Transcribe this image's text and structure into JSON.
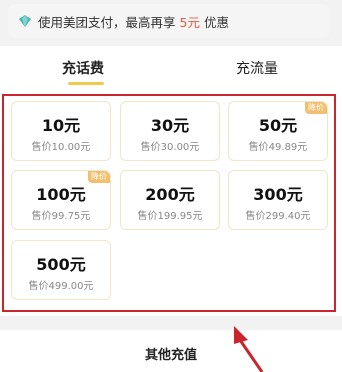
{
  "promo": {
    "text_before": "使用美团支付，最高再享",
    "highlight": "5元",
    "text_after": "优惠",
    "icon": "diamond-icon"
  },
  "tabs": [
    {
      "label": "充话费",
      "selected": true
    },
    {
      "label": "充流量",
      "selected": false
    }
  ],
  "cards": [
    {
      "amount": "10元",
      "price": "售价10.00元",
      "tag": ""
    },
    {
      "amount": "30元",
      "price": "售价30.00元",
      "tag": ""
    },
    {
      "amount": "50元",
      "price": "售价49.89元",
      "tag": "降价"
    },
    {
      "amount": "100元",
      "price": "售价99.75元",
      "tag": "降价"
    },
    {
      "amount": "200元",
      "price": "售价199.95元",
      "tag": ""
    },
    {
      "amount": "300元",
      "price": "售价299.40元",
      "tag": ""
    },
    {
      "amount": "500元",
      "price": "售价499.00元",
      "tag": ""
    }
  ],
  "bottom": {
    "label": "其他充值"
  },
  "colors": {
    "highlight": "#e85a3a",
    "tab_underline": "#f2c94c",
    "annotation": "#c8262c",
    "tag": "#f0c070"
  }
}
